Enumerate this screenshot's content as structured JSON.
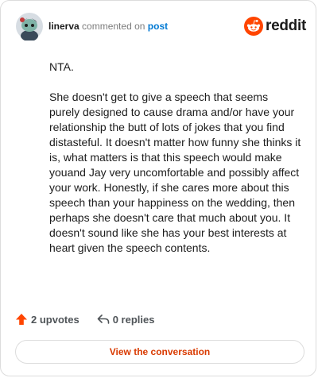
{
  "header": {
    "username": "linerva",
    "action_text": "commented on",
    "post_link": "post",
    "logo_text": "reddit",
    "avatar_icon": "snoo-avatar-icon",
    "logo_icon": "reddit-snoo-logo-icon"
  },
  "comment": {
    "paragraphs": [
      "NTA.",
      "She doesn't get to give a speech that seems purely designed to cause drama and/or have your relationship the butt of lots of jokes that you find distasteful. It doesn't matter how funny she thinks it is, what matters is that this speech would make youand Jay very uncomfortable and possibly affect your work. Honestly, if she cares more about this speech than your happiness on the wedding, then perhaps she doesn't care that much about you. It doesn't sound like she has your best interests at heart given the speech contents."
    ]
  },
  "actions": {
    "upvotes_label": "2 upvotes",
    "replies_label": "0 replies",
    "upvote_icon": "upvote-arrow-icon",
    "reply_icon": "reply-arrow-icon"
  },
  "footer": {
    "view_button_label": "View the conversation"
  },
  "colors": {
    "brand_orange": "#ff4500",
    "button_text": "#d93a00",
    "link_blue": "#0079d3",
    "border": "#dcdcdc"
  }
}
